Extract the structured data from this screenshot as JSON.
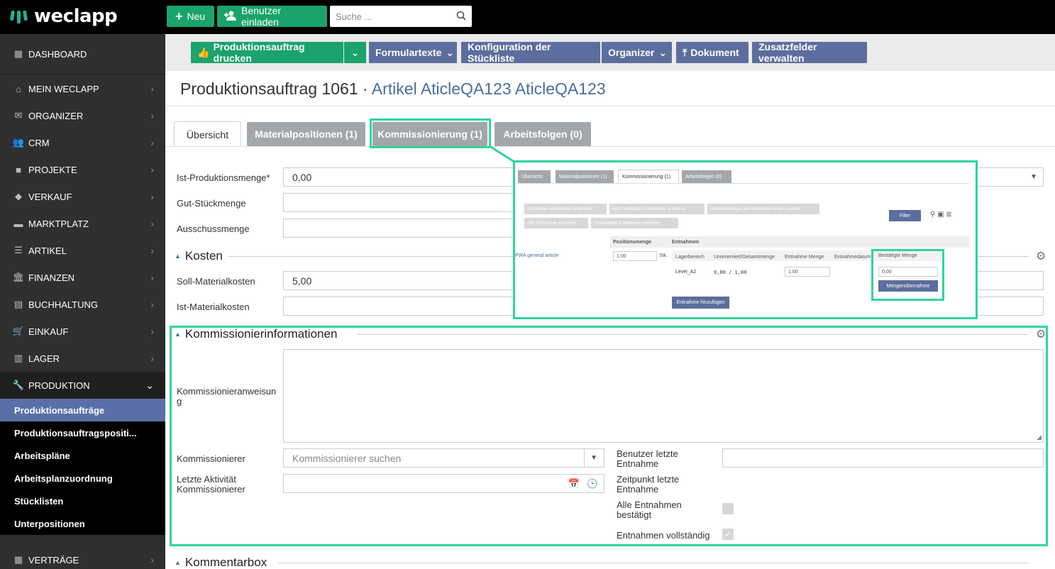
{
  "app": {
    "logo": "weclapp",
    "new_button": "Neu",
    "invite_button": "Benutzer einladen",
    "search_placeholder": "Suche ..."
  },
  "sidebar": {
    "items": [
      {
        "label": "DASHBOARD",
        "icon": "dashboard-icon"
      },
      {
        "label": "MEIN WECLAPP",
        "icon": "home-icon"
      },
      {
        "label": "ORGANIZER",
        "icon": "mail-icon"
      },
      {
        "label": "CRM",
        "icon": "users-icon"
      },
      {
        "label": "PROJEKTE",
        "icon": "briefcase-icon"
      },
      {
        "label": "VERKAUF",
        "icon": "tag-icon"
      },
      {
        "label": "MARKTPLATZ",
        "icon": "store-icon"
      },
      {
        "label": "ARTIKEL",
        "icon": "list-icon"
      },
      {
        "label": "FINANZEN",
        "icon": "bank-icon"
      },
      {
        "label": "BUCHHALTUNG",
        "icon": "calculator-icon"
      },
      {
        "label": "EINKAUF",
        "icon": "cart-icon"
      },
      {
        "label": "LAGER",
        "icon": "warehouse-icon"
      },
      {
        "label": "PRODUKTION",
        "icon": "wrench-icon"
      },
      {
        "label": "VERTRÄGE",
        "icon": "contract-icon"
      }
    ],
    "production_sub": [
      "Produktionsaufträge",
      "Produktionsauftragspositi...",
      "Arbeitspläne",
      "Arbeitsplanzuordnung",
      "Stücklisten",
      "Unterpositionen"
    ]
  },
  "toolbar": {
    "print": "Produktionsauftrag drucken",
    "form_texts": "Formulartexte",
    "bom_config": "Konfiguration der Stückliste",
    "organizer": "Organizer",
    "document": "Dokument",
    "extra_fields": "Zusatzfelder verwalten"
  },
  "page": {
    "title_prefix": "Produktionsauftrag 1061 · ",
    "title_link": "Artikel AticleQA123 AticleQA123"
  },
  "tabs": [
    "Übersicht",
    "Materialpositionen (1)",
    "Kommissionierung (1)",
    "Arbeitsfolgen (0)"
  ],
  "form": {
    "ist_menge_label": "Ist-Produktionsmenge*",
    "ist_menge_value": "0,00",
    "gut_label": "Gut-Stückmenge",
    "ausschuss_label": "Ausschussmenge",
    "kosten_title": "Kosten",
    "soll_label": "Soll-Materialkosten",
    "soll_value": "5,00",
    "ist_kosten_label": "Ist-Materialkosten",
    "komm_title": "Kommissionierinformationen",
    "anweisung_label": "Kommissionieranweisung",
    "kommissionierer_label": "Kommissionierer",
    "kommissionierer_placeholder": "Kommissionierer suchen",
    "letzte_aktivitaet_label": "Letzte Aktivität Kommissionierer",
    "benutzer_label": "Benutzer letzte Entnahme",
    "zeitpunkt_label": "Zeitpunkt letzte Entnahme",
    "alle_label": "Alle Entnahmen bestätigt",
    "vollstaendig_label": "Entnahmen vollständig",
    "kommentar_title": "Kommentarbox"
  },
  "inset": {
    "tabs": [
      "Übersicht",
      "Materialpositionen (1)",
      "Kommissionierung (1)",
      "Arbeitsfolgen (0)"
    ],
    "buttons": [
      "Entnahmen vorschlagen/ergänzen",
      "Nicht verfügbare Entnahmen entfernen",
      "Positionsmengen auf Entnahmemengen setzen",
      "Alle Entnahmen entfernen",
      "Unbestätigte Entnahmen entfernen"
    ],
    "filter": "Filter",
    "col_positionsmenge": "Positionsmenge",
    "col_entnahmen": "Entnahmen",
    "article": "PWA general article",
    "pos_value": "1,00",
    "unit": "Stk.",
    "sub_headers": [
      "Lagerbereich",
      "Unreserviert/Gesamtmenge",
      "Entnahme Menge",
      "Entnahmedatum",
      "Bestätigte Menge"
    ],
    "lagerbereich": "Level_A2",
    "unreserviert": "0,00 / 1,00",
    "entnahme_menge": "1,00",
    "bestaetigt": "0,00",
    "mengenuebernahme": "Mengenübernahme",
    "add_button": "Entnahme hinzufügen"
  },
  "colors": {
    "accent_green": "#1aa36b",
    "highlight": "#2fd59a",
    "button_blue": "#5c6e9e",
    "sidebar": "#2f2f2f"
  }
}
